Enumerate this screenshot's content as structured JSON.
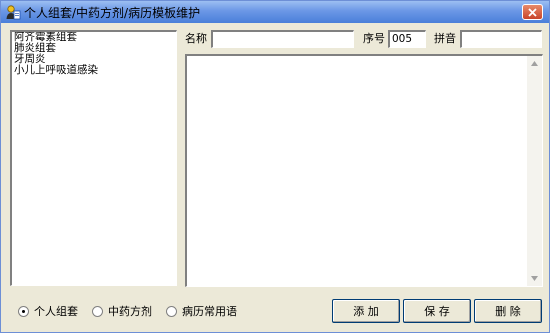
{
  "window": {
    "title": "个人组套/中药方剂/病历模板维护"
  },
  "list": {
    "items": [
      {
        "label": "阿齐霉素组套"
      },
      {
        "label": "肺炎组套"
      },
      {
        "label": "牙周炎"
      },
      {
        "label": "小儿上呼吸道感染"
      }
    ]
  },
  "form": {
    "name_label": "名称",
    "name_value": "",
    "seq_label": "序号",
    "seq_value": "005",
    "pinyin_label": "拼音",
    "pinyin_value": ""
  },
  "memo": {
    "content": ""
  },
  "radios": [
    {
      "label": "个人组套",
      "checked": true
    },
    {
      "label": "中药方剂",
      "checked": false
    },
    {
      "label": "病历常用语",
      "checked": false
    }
  ],
  "buttons": {
    "add": "添 加",
    "save": "保 存",
    "delete": "删 除"
  },
  "colors": {
    "window_bg": "#ece9d8",
    "titlebar": "#6b97e6",
    "close": "#c9452a"
  }
}
